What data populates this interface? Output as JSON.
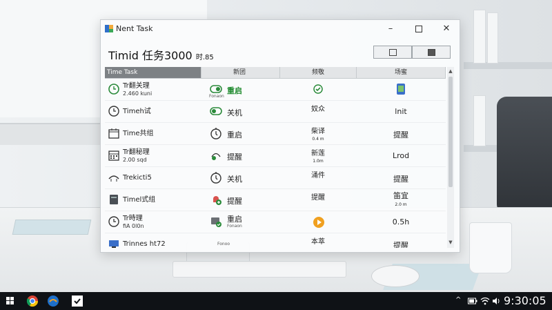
{
  "window": {
    "title": "Nent Task",
    "heading": "Timid 任务3000",
    "heading_sub": "时.85",
    "controls": {
      "minimize": "–",
      "maximize": "",
      "close": "✕"
    }
  },
  "table": {
    "headers": [
      "Time Task",
      "新团",
      "频敬",
      "场蜜"
    ],
    "rows": [
      {
        "name": "Tr翻关理",
        "name_sub": "2.460 kuni",
        "name_icon": "clock-icon",
        "action": "重启",
        "action_sub": "Fonaon",
        "action_icon": "power-toggle-icon",
        "action_green": true,
        "status": "",
        "status_icon": "green-check-icon",
        "right": "",
        "right_icon": "phone-app-icon"
      },
      {
        "name": "Timeh试",
        "name_sub": "",
        "name_icon": "clock-icon",
        "action": "关机",
        "action_sub": "",
        "action_icon": "power-toggle-icon",
        "action_green": false,
        "status": "奴众",
        "status_icon": "",
        "right": "lnit",
        "right_icon": ""
      },
      {
        "name": "Time共组",
        "name_sub": "",
        "name_icon": "calendar-icon",
        "action": "重启",
        "action_sub": "",
        "action_icon": "stopwatch-icon",
        "action_green": false,
        "status": "柴译",
        "status_sub": "0.4 m",
        "status_icon": "",
        "right": "提醒",
        "right_icon": ""
      },
      {
        "name": "Tr翻秘理",
        "name_sub": "2.00 sqd",
        "name_icon": "calendar-grid-icon",
        "action": "提醒",
        "action_sub": "",
        "action_icon": "arrow-bell-icon",
        "action_green": false,
        "status": "新莲",
        "status_sub": "1.0m",
        "status_icon": "",
        "right": "Lrod",
        "right_icon": ""
      },
      {
        "name": "Trekicti5",
        "name_sub": "",
        "name_icon": "trend-icon",
        "action": "关机",
        "action_sub": "",
        "action_icon": "stopwatch-icon",
        "action_green": false,
        "status": "涌件",
        "status_icon": "",
        "right": "提醒",
        "right_icon": ""
      },
      {
        "name": "Timel式组",
        "name_sub": "",
        "name_icon": "server-icon",
        "action": "提醒",
        "action_sub": "",
        "action_icon": "bell-plus-icon",
        "action_green": false,
        "status": "提醒",
        "status_icon": "",
        "right": "笛宜",
        "right_sub": "2.0 m",
        "right_icon": ""
      },
      {
        "name": "Tr時理",
        "name_sub": "fiA 0l0n",
        "name_icon": "clock-icon",
        "action": "重启",
        "action_sub": "Fonaon",
        "action_icon": "device-check-icon",
        "action_green": false,
        "status": "",
        "status_icon": "play-icon",
        "right": "0.5h",
        "right_icon": ""
      },
      {
        "name": "Trinnes ht72",
        "name_sub": "",
        "name_icon": "tv-icon",
        "action": "",
        "action_sub": "Fonoo",
        "action_icon": "",
        "action_green": false,
        "status": "本萃",
        "status_icon": "",
        "right": "提醒",
        "right_icon": ""
      }
    ]
  },
  "taskbar": {
    "clock": "9:30:05",
    "tray_chevron": "^"
  },
  "colors": {
    "accent_green": "#1f8a2e",
    "header_dark": "#7d8185",
    "taskbar": "#0f1216"
  }
}
